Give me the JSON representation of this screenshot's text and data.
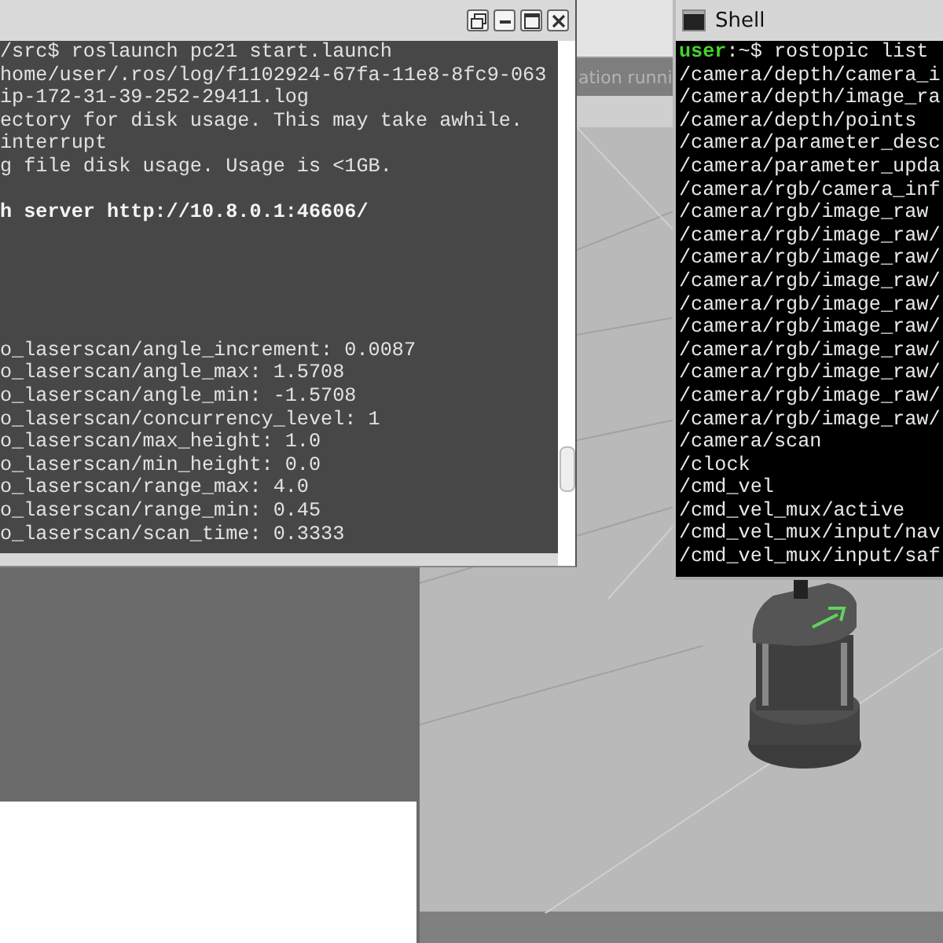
{
  "simulator": {
    "status": "ation runni"
  },
  "terminal": {
    "blocks": [
      {
        "lines": [
          {
            "text": "/src$ roslaunch pc21 start.launch",
            "bold": false
          },
          {
            "text": "home/user/.ros/log/f1102924-67fa-11e8-8fc9-063",
            "bold": false
          },
          {
            "text": "ip-172-31-39-252-29411.log",
            "bold": false
          },
          {
            "text": "ectory for disk usage. This may take awhile.",
            "bold": false
          },
          {
            "text": "interrupt",
            "bold": false
          },
          {
            "text": "g file disk usage. Usage is <1GB.",
            "bold": false
          }
        ]
      },
      {
        "lines": [
          {
            "text": "h server http://10.8.0.1:46606/",
            "bold": true
          }
        ]
      },
      {
        "lines": [
          {
            "text": "o_laserscan/angle_increment: 0.0087",
            "bold": false
          },
          {
            "text": "o_laserscan/angle_max: 1.5708",
            "bold": false
          },
          {
            "text": "o_laserscan/angle_min: -1.5708",
            "bold": false
          },
          {
            "text": "o_laserscan/concurrency_level: 1",
            "bold": false
          },
          {
            "text": "o_laserscan/max_height: 1.0",
            "bold": false
          },
          {
            "text": "o_laserscan/min_height: 0.0",
            "bold": false
          },
          {
            "text": "o_laserscan/range_max: 4.0",
            "bold": false
          },
          {
            "text": "o_laserscan/range_min: 0.45",
            "bold": false
          },
          {
            "text": "o_laserscan/scan_time: 0.3333",
            "bold": false
          }
        ]
      }
    ]
  },
  "shell": {
    "title": "Shell",
    "prompt": "**user**:~$ rostopic list",
    "lines": [
      "/camera/depth/camera_i",
      "/camera/depth/image_ra",
      "/camera/depth/points",
      "/camera/parameter_desc",
      "/camera/parameter_upda",
      "/camera/rgb/camera_inf",
      "/camera/rgb/image_raw",
      "/camera/rgb/image_raw/",
      "/camera/rgb/image_raw/",
      "/camera/rgb/image_raw/",
      "/camera/rgb/image_raw/",
      "/camera/rgb/image_raw/",
      "/camera/rgb/image_raw/",
      "/camera/rgb/image_raw/",
      "/camera/rgb/image_raw/",
      "/camera/rgb/image_raw/",
      "/camera/scan",
      "/clock",
      "/cmd_vel",
      "/cmd_vel_mux/active",
      "/cmd_vel_mux/input/nav",
      "/cmd_vel_mux/input/saf"
    ]
  }
}
